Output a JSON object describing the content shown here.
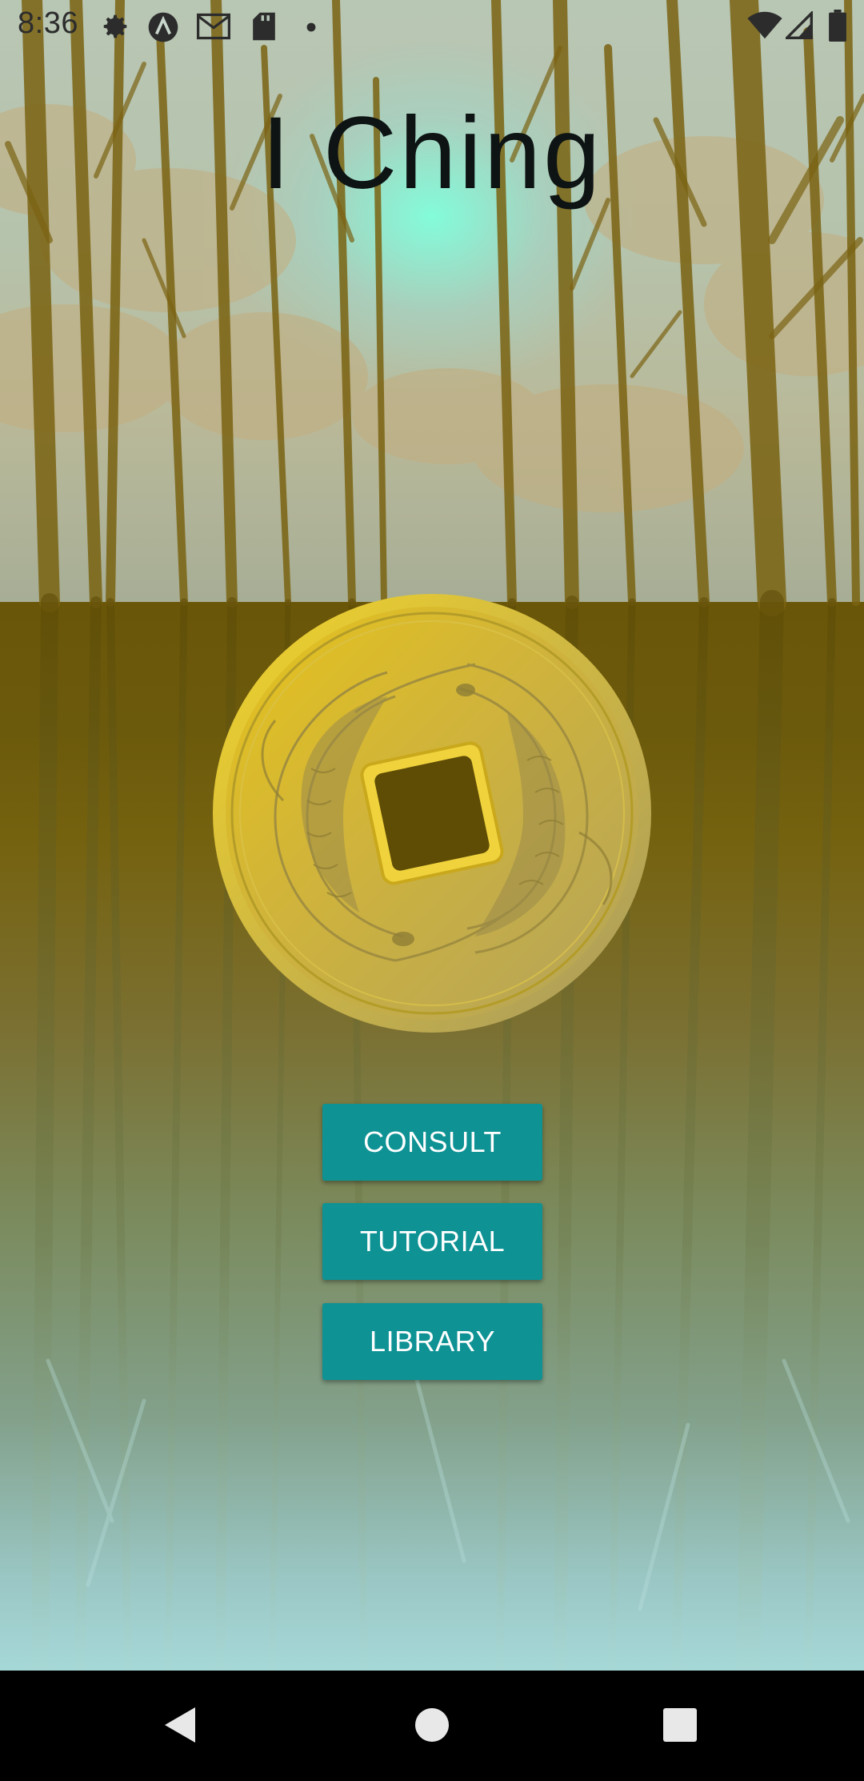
{
  "status_bar": {
    "time": "8:36",
    "left_icons": [
      "gear-icon",
      "a-circle-icon",
      "gmail-icon",
      "sd-card-icon",
      "dot-icon"
    ],
    "right_icons": [
      "wifi-icon",
      "signal-icon",
      "battery-icon"
    ]
  },
  "app": {
    "title": "I Ching"
  },
  "buttons": {
    "consult": "CONSULT",
    "tutorial": "TUTORIAL",
    "library": "LIBRARY"
  },
  "colors": {
    "button": "#0e9294",
    "button_text": "#ffffff",
    "coin_gold": "#e4c01a",
    "water_top": "#6a5608"
  },
  "nav_bar": {
    "icons": [
      "back-icon",
      "home-icon",
      "recents-icon"
    ]
  }
}
